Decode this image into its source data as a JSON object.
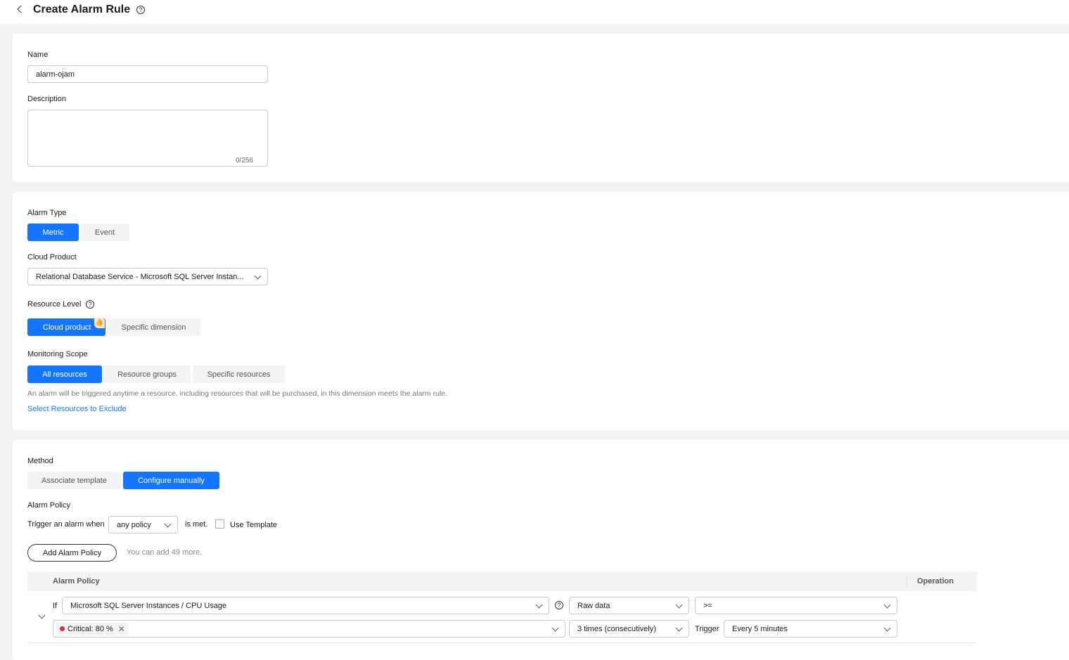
{
  "header": {
    "title": "Create Alarm Rule"
  },
  "basic": {
    "name_label": "Name",
    "name_value": "alarm-ojam",
    "desc_label": "Description",
    "desc_value": "",
    "desc_counter": "0/256"
  },
  "alarm": {
    "type_label": "Alarm Type",
    "types": [
      "Metric",
      "Event"
    ],
    "product_label": "Cloud Product",
    "product_value": "Relational Database Service - Microsoft SQL Server Instan...",
    "level_label": "Resource Level",
    "levels": [
      "Cloud product",
      "Specific dimension"
    ],
    "scope_label": "Monitoring Scope",
    "scopes": [
      "All resources",
      "Resource groups",
      "Specific resources"
    ],
    "scope_hint": "An alarm will be triggered anytime a resource, including resources that will be purchased, in this dimension meets the alarm rule.",
    "exclude_link": "Select Resources to Exclude"
  },
  "method": {
    "label": "Method",
    "options": [
      "Associate template",
      "Configure manually"
    ],
    "policy_label": "Alarm Policy",
    "trigger_prefix": "Trigger an alarm when",
    "trigger_value": "any policy",
    "trigger_suffix": "is met.",
    "use_template": "Use Template",
    "add_button": "Add Alarm Policy",
    "add_hint": "You can add 49 more.",
    "table_headers": [
      "Alarm Policy",
      "Operation"
    ],
    "row": {
      "if": "If",
      "metric": "Microsoft SQL Server Instances / CPU Usage",
      "aggregation": "Raw data",
      "operator": ">=",
      "tag": "Critical: 80 %",
      "times": "3 times (consecutively)",
      "trigger_label": "Trigger",
      "frequency": "Every 5 minutes"
    }
  },
  "colors": {
    "primary": "#1476ff",
    "critical": "#e8262d"
  }
}
